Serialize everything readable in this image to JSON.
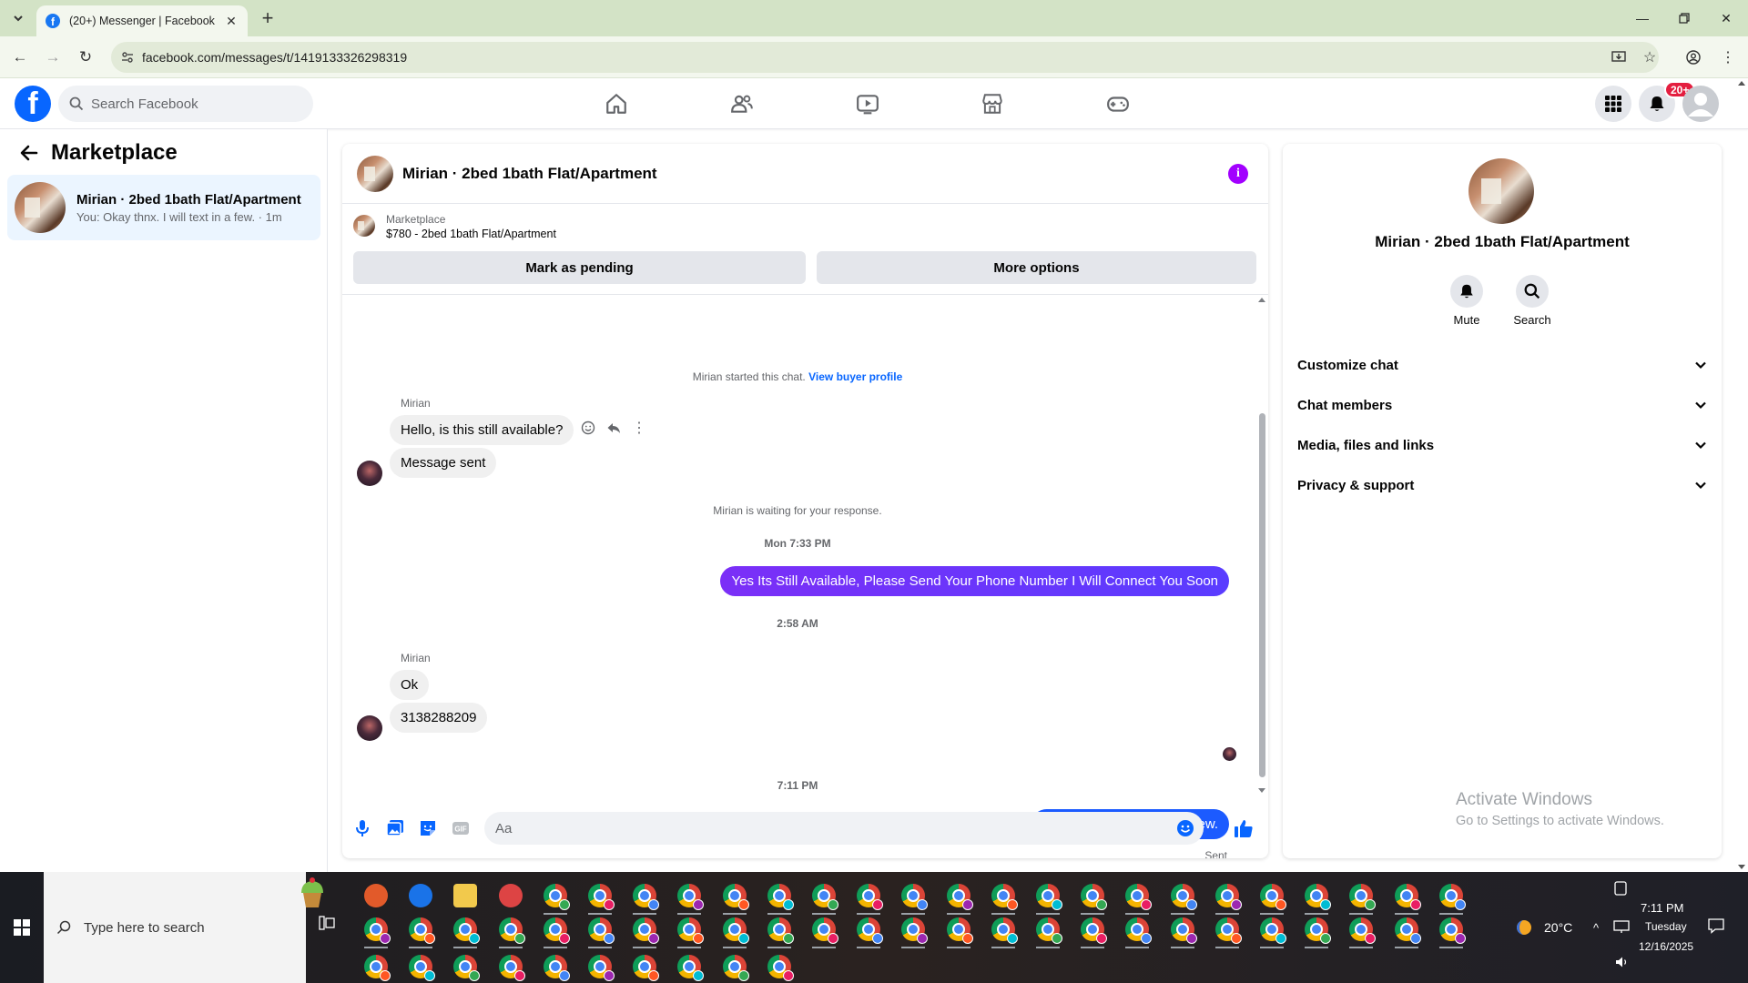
{
  "browser": {
    "tab_title": "(20+) Messenger | Facebook",
    "url": "facebook.com/messages/t/1419133326298319"
  },
  "fb": {
    "search_placeholder": "Search Facebook",
    "notification_badge": "20+"
  },
  "left": {
    "title": "Marketplace",
    "conversation": {
      "name": "Mirian · 2bed 1bath Flat/Apartment",
      "snippet": "You: Okay thnx. I will text in a few. · 1m"
    }
  },
  "chat": {
    "title": "Mirian · 2bed 1bath Flat/Apartment",
    "marketplace_label": "Marketplace",
    "listing": "$780 - 2bed 1bath Flat/Apartment",
    "mark_pending": "Mark as pending",
    "more_options": "More options",
    "started_text": "Mirian started this chat.",
    "view_profile": "View buyer profile",
    "sender1": "Mirian",
    "msg1": "Hello, is this still available?",
    "msg2": "Message sent",
    "waiting": "Mirian is waiting for your response.",
    "ts1": "Mon 7:33 PM",
    "reply1": "Yes Its Still Available, Please Send Your Phone Number I Will Connect You Soon",
    "ts2": "2:58 AM",
    "sender2": "Mirian",
    "msg3": "Ok",
    "msg4": "3138288209",
    "ts3": "7:11 PM",
    "reply2": "Okay thnx. I will text in a few.",
    "sent_label": "Sent",
    "input_placeholder": "Aa"
  },
  "right": {
    "name": "Mirian · 2bed 1bath Flat/Apartment",
    "mute": "Mute",
    "search": "Search",
    "rows": [
      "Customize chat",
      "Chat members",
      "Media, files and links",
      "Privacy & support"
    ]
  },
  "watermark": {
    "line1": "Activate Windows",
    "line2": "Go to Settings to activate Windows."
  },
  "taskbar": {
    "search_placeholder": "Type here to search",
    "weather": "20°C",
    "time": "7:11 PM",
    "day": "Tuesday",
    "date": "12/16/2025"
  },
  "colors": {
    "fb_blue": "#0866ff",
    "outgoing_purple": "#7b2ff7",
    "outgoing_blue": "#1c5bff",
    "browser_green": "#d3e3c6"
  }
}
